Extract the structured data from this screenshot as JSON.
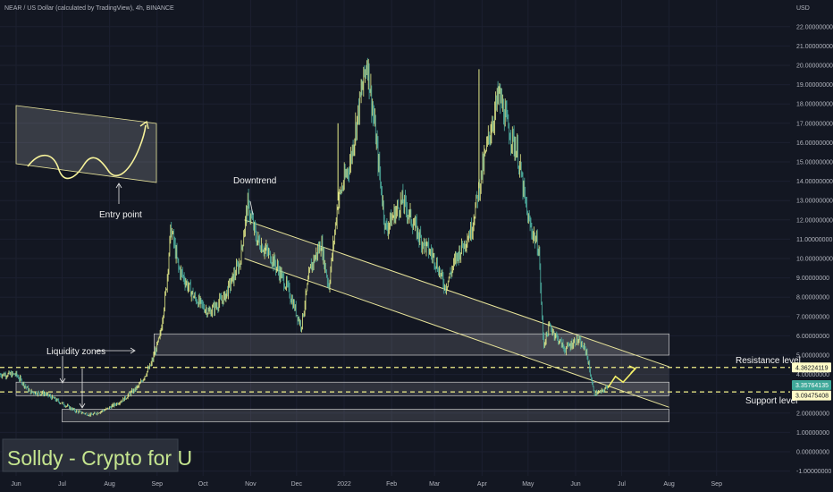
{
  "header": {
    "title": "NEAR / US Dollar (calculated by TradingView), 4h, BINANCE",
    "currency": "USD"
  },
  "colors": {
    "background": "#131722",
    "candle_up": "#e5ec8a",
    "candle_down": "#4fb3a3",
    "trendline": "#e8e49a",
    "zone_fill": "#d9d9d9",
    "level_dash": "#f2f08a",
    "arrow": "#f4f06a",
    "watermark_bg": "#252a35",
    "watermark_text": "#bfe08a",
    "resistance_tag": "#fffcc8",
    "current_tag": "#3fa99a",
    "support_tag": "#fffcc8"
  },
  "watermark": "Solldy - Crypto for U",
  "annotations": {
    "downtrend": "Downtrend",
    "entry_point": "Entry point",
    "liquidity_zones": "Liquidity zones",
    "resistance": "Resistance level",
    "support": "Support level"
  },
  "chart_data": {
    "type": "candlestick",
    "title": "NEAR / US Dollar (calculated by TradingView), 4h, BINANCE",
    "y_unit": "USD",
    "ylim": [
      -1.0,
      23.0
    ],
    "yticks": [
      "22.00000000",
      "21.00000000",
      "20.00000000",
      "19.00000000",
      "18.00000000",
      "17.00000000",
      "16.00000000",
      "15.00000000",
      "14.00000000",
      "13.00000000",
      "12.00000000",
      "11.00000000",
      "10.00000000",
      "9.00000000",
      "8.00000000",
      "7.00000000",
      "6.00000000",
      "5.00000000",
      "4.00000000",
      "3.00000000",
      "2.00000000",
      "1.00000000",
      "0.00000000",
      "-1.00000000"
    ],
    "xticks": [
      "Jun",
      "Jul",
      "Aug",
      "Sep",
      "Oct",
      "Nov",
      "Dec",
      "2022",
      "Feb",
      "Mar",
      "Apr",
      "May",
      "Jun",
      "Jul",
      "Aug",
      "Sep"
    ],
    "price_path": [
      {
        "t": "2021-06-01",
        "price": 4.0
      },
      {
        "t": "2021-06-10",
        "price": 3.1
      },
      {
        "t": "2021-06-20",
        "price": 3.0
      },
      {
        "t": "2021-07-01",
        "price": 2.5
      },
      {
        "t": "2021-07-10",
        "price": 2.1
      },
      {
        "t": "2021-07-20",
        "price": 1.9
      },
      {
        "t": "2021-07-30",
        "price": 2.2
      },
      {
        "t": "2021-08-10",
        "price": 2.7
      },
      {
        "t": "2021-08-20",
        "price": 3.4
      },
      {
        "t": "2021-08-28",
        "price": 4.5
      },
      {
        "t": "2021-09-03",
        "price": 6.0
      },
      {
        "t": "2021-09-07",
        "price": 8.5
      },
      {
        "t": "2021-09-10",
        "price": 11.6
      },
      {
        "t": "2021-09-15",
        "price": 9.5
      },
      {
        "t": "2021-09-25",
        "price": 8.0
      },
      {
        "t": "2021-10-05",
        "price": 7.2
      },
      {
        "t": "2021-10-15",
        "price": 8.0
      },
      {
        "t": "2021-10-25",
        "price": 9.8
      },
      {
        "t": "2021-10-30",
        "price": 12.8
      },
      {
        "t": "2021-11-05",
        "price": 11.0
      },
      {
        "t": "2021-11-15",
        "price": 10.0
      },
      {
        "t": "2021-11-25",
        "price": 8.5
      },
      {
        "t": "2021-12-04",
        "price": 6.5
      },
      {
        "t": "2021-12-10",
        "price": 9.5
      },
      {
        "t": "2021-12-17",
        "price": 10.8
      },
      {
        "t": "2021-12-22",
        "price": 8.5
      },
      {
        "t": "2021-12-28",
        "price": 13.0
      },
      {
        "t": "2022-01-05",
        "price": 15.0
      },
      {
        "t": "2022-01-10",
        "price": 17.5
      },
      {
        "t": "2022-01-16",
        "price": 20.3
      },
      {
        "t": "2022-01-22",
        "price": 16.0
      },
      {
        "t": "2022-01-28",
        "price": 11.5
      },
      {
        "t": "2022-02-08",
        "price": 13.0
      },
      {
        "t": "2022-02-20",
        "price": 11.0
      },
      {
        "t": "2022-03-01",
        "price": 10.0
      },
      {
        "t": "2022-03-08",
        "price": 8.5
      },
      {
        "t": "2022-03-15",
        "price": 10.0
      },
      {
        "t": "2022-03-25",
        "price": 11.5
      },
      {
        "t": "2022-04-01",
        "price": 14.5
      },
      {
        "t": "2022-04-06",
        "price": 16.5
      },
      {
        "t": "2022-04-12",
        "price": 18.5
      },
      {
        "t": "2022-04-17",
        "price": 17.0
      },
      {
        "t": "2022-04-24",
        "price": 15.5
      },
      {
        "t": "2022-05-01",
        "price": 12.0
      },
      {
        "t": "2022-05-08",
        "price": 10.5
      },
      {
        "t": "2022-05-11",
        "price": 5.5
      },
      {
        "t": "2022-05-15",
        "price": 6.5
      },
      {
        "t": "2022-05-25",
        "price": 5.3
      },
      {
        "t": "2022-06-02",
        "price": 5.8
      },
      {
        "t": "2022-06-08",
        "price": 5.2
      },
      {
        "t": "2022-06-13",
        "price": 3.0
      },
      {
        "t": "2022-06-18",
        "price": 3.1
      },
      {
        "t": "2022-06-22",
        "price": 3.36
      }
    ],
    "spikes": [
      {
        "t": "2021-12-28",
        "high": 17.0
      },
      {
        "t": "2022-03-30",
        "high": 19.8
      }
    ],
    "levels": [
      {
        "name": "Resistance level",
        "value": 4.36224119,
        "label": "4.36224119"
      },
      {
        "name": "current",
        "value": 3.35764135,
        "label": "3.35764135"
      },
      {
        "name": "Support level",
        "value": 3.09475408,
        "label": "3.09475408"
      }
    ],
    "zones": [
      {
        "from": "2021-08-30",
        "to": "2022-08-01",
        "low": 5.0,
        "high": 6.1
      },
      {
        "from": "2021-06-01",
        "to": "2022-08-01",
        "low": 2.9,
        "high": 3.6
      },
      {
        "from": "2021-07-01",
        "to": "2022-08-01",
        "low": 1.55,
        "high": 2.2
      }
    ],
    "channel": {
      "upper": [
        {
          "t": "2021-10-28",
          "price": 12.0
        },
        {
          "t": "2022-08-01",
          "price": 4.4
        }
      ],
      "lower": [
        {
          "t": "2021-10-28",
          "price": 10.0
        },
        {
          "t": "2022-08-01",
          "price": 2.3
        }
      ]
    },
    "projection": [
      {
        "t": "2022-06-22",
        "price": 3.3
      },
      {
        "t": "2022-06-27",
        "price": 3.9
      },
      {
        "t": "2022-07-02",
        "price": 3.6
      },
      {
        "t": "2022-07-10",
        "price": 4.3
      }
    ]
  }
}
